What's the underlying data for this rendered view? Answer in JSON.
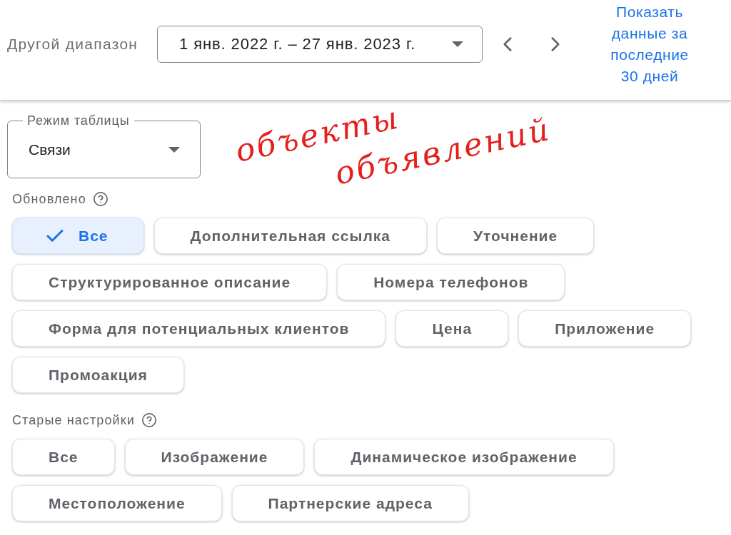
{
  "date_range": {
    "label": "Другой диапазон",
    "value": "1 янв. 2022 г. – 27 янв. 2023 г.",
    "last_30_days_link": "Показать данные за последние 30 дней"
  },
  "table_mode": {
    "label": "Режим таблицы",
    "value": "Связи"
  },
  "filter_groups": [
    {
      "title": "Обновлено",
      "chips": [
        {
          "label": "Все",
          "selected": true
        },
        {
          "label": "Дополнительная ссылка",
          "selected": false
        },
        {
          "label": "Уточнение",
          "selected": false
        },
        {
          "label": "Структурированное описание",
          "selected": false
        },
        {
          "label": "Номера телефонов",
          "selected": false
        },
        {
          "label": "Форма для потенциальных клиентов",
          "selected": false
        },
        {
          "label": "Цена",
          "selected": false
        },
        {
          "label": "Приложение",
          "selected": false
        },
        {
          "label": "Промоакция",
          "selected": false
        }
      ]
    },
    {
      "title": "Старые настройки",
      "chips": [
        {
          "label": "Все",
          "selected": false
        },
        {
          "label": "Изображение",
          "selected": false
        },
        {
          "label": "Динамическое изображение",
          "selected": false
        },
        {
          "label": "Местоположение",
          "selected": false
        },
        {
          "label": "Партнерские адреса",
          "selected": false
        }
      ]
    }
  ],
  "handwritten_note": "объекты объявлений"
}
